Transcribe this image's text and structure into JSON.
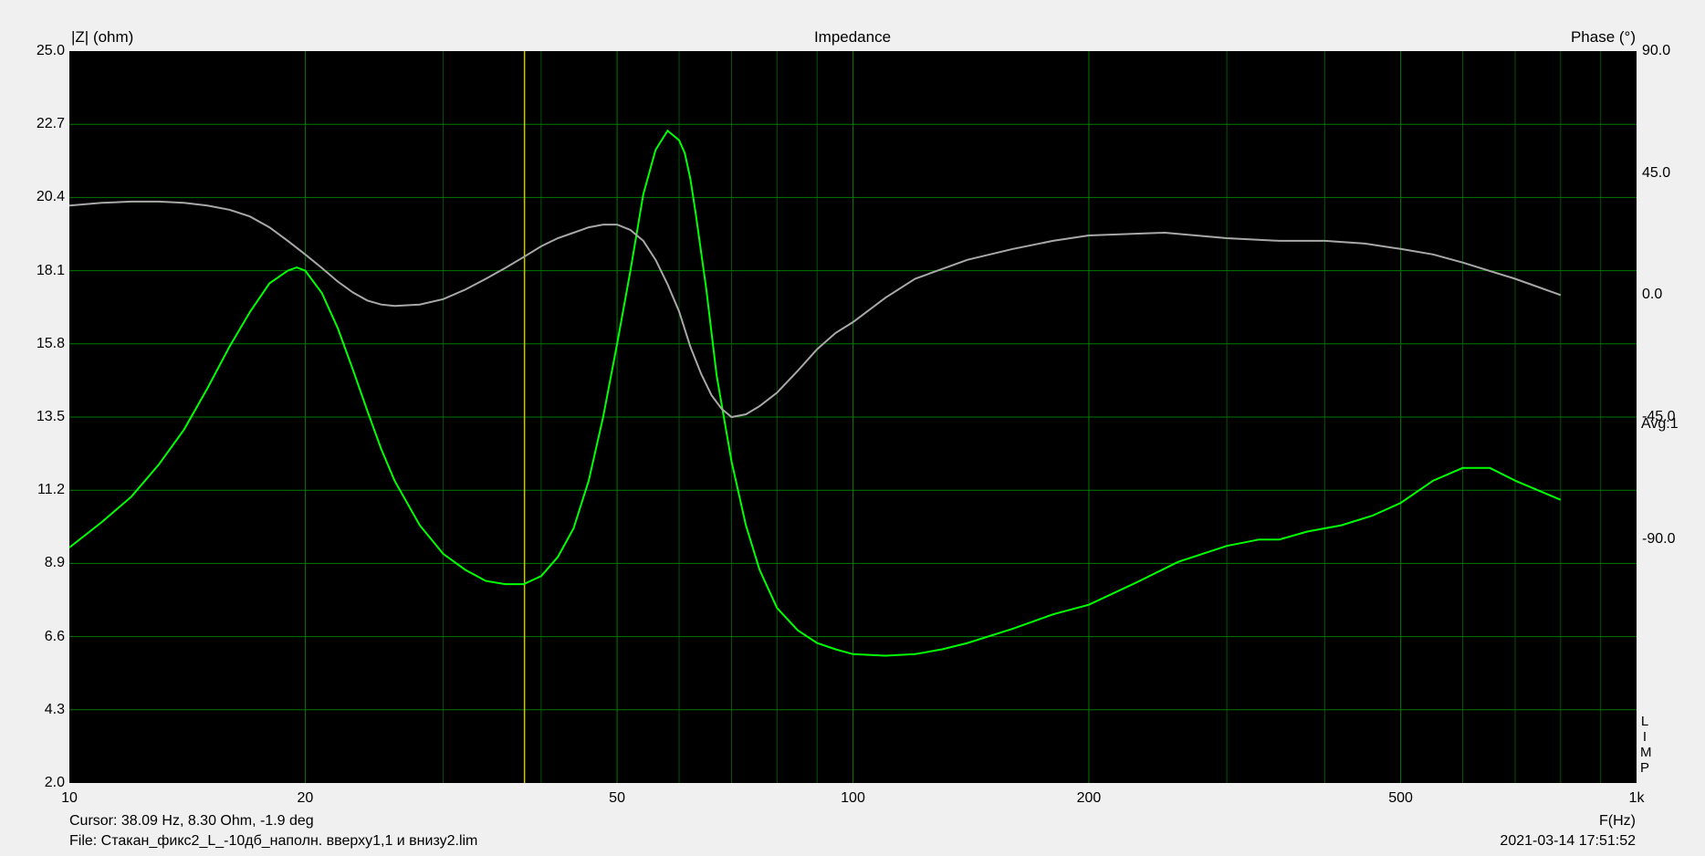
{
  "chart_data": {
    "type": "line",
    "title": "Impedance",
    "ylabel_left": "|Z| (ohm)",
    "ylabel_right": "Phase (°)",
    "xlabel": "F(Hz)",
    "xscale": "log",
    "xlim": [
      10,
      1000
    ],
    "ylim_left": [
      2.0,
      25.0
    ],
    "ylim_right": [
      -180,
      90
    ],
    "x_tick_labels": [
      {
        "v": 10,
        "t": "10"
      },
      {
        "v": 20,
        "t": "20"
      },
      {
        "v": 50,
        "t": "50"
      },
      {
        "v": 100,
        "t": "100"
      },
      {
        "v": 200,
        "t": "200"
      },
      {
        "v": 500,
        "t": "500"
      },
      {
        "v": 1000,
        "t": "1k"
      }
    ],
    "y_left_ticks": [
      "2.0",
      "4.3",
      "6.6",
      "8.9",
      "11.2",
      "13.5",
      "15.8",
      "18.1",
      "20.4",
      "22.7",
      "25.0"
    ],
    "y_right_ticks": [
      {
        "v": 90,
        "t": "90.0"
      },
      {
        "v": 45,
        "t": "45.0"
      },
      {
        "v": 0,
        "t": "0.0"
      },
      {
        "v": -45,
        "t": "-45.0"
      },
      {
        "v": -90,
        "t": "-90.0"
      }
    ],
    "grid": true,
    "avg_label": "Avg:1",
    "lim_label": [
      "L",
      "I",
      "M",
      "P"
    ],
    "cursor": {
      "x": 38.09
    },
    "series": [
      {
        "color": "#00ff00",
        "axis": "left",
        "x": [
          10,
          11,
          12,
          13,
          14,
          15,
          16,
          17,
          18,
          19,
          19.5,
          20,
          21,
          22,
          23,
          24,
          25,
          26,
          28,
          30,
          32,
          34,
          36,
          38,
          40,
          42,
          44,
          46,
          48,
          50,
          52,
          54,
          56,
          58,
          60,
          61,
          62,
          63,
          65,
          67,
          70,
          73,
          76,
          80,
          85,
          90,
          95,
          100,
          110,
          120,
          130,
          140,
          160,
          180,
          200,
          230,
          260,
          300,
          330,
          350,
          380,
          420,
          460,
          500,
          550,
          600,
          650,
          700,
          800
        ],
        "y": [
          9.4,
          10.2,
          11.0,
          12.0,
          13.1,
          14.4,
          15.7,
          16.8,
          17.7,
          18.1,
          18.2,
          18.1,
          17.4,
          16.3,
          15.0,
          13.7,
          12.5,
          11.5,
          10.1,
          9.2,
          8.7,
          8.35,
          8.25,
          8.25,
          8.5,
          9.1,
          10.0,
          11.5,
          13.5,
          15.8,
          18.1,
          20.5,
          21.9,
          22.5,
          22.2,
          21.8,
          21.0,
          19.9,
          17.5,
          14.8,
          12.1,
          10.1,
          8.7,
          7.5,
          6.8,
          6.4,
          6.2,
          6.05,
          6.0,
          6.05,
          6.2,
          6.4,
          6.85,
          7.3,
          7.6,
          8.3,
          8.95,
          9.45,
          9.65,
          9.65,
          9.9,
          10.1,
          10.4,
          10.8,
          11.5,
          11.9,
          11.9,
          11.5,
          10.9
        ]
      },
      {
        "color": "#a8a8a8",
        "axis": "right",
        "x": [
          10,
          11,
          12,
          13,
          14,
          15,
          16,
          17,
          18,
          19,
          20,
          21,
          22,
          23,
          24,
          25,
          26,
          28,
          30,
          32,
          34,
          36,
          38,
          40,
          42,
          44,
          46,
          48,
          50,
          52,
          54,
          56,
          58,
          60,
          62,
          64,
          66,
          68,
          70,
          73,
          76,
          80,
          85,
          90,
          95,
          100,
          110,
          120,
          140,
          160,
          180,
          200,
          250,
          300,
          350,
          400,
          450,
          500,
          550,
          600,
          700,
          800
        ],
        "y": [
          33,
          34,
          34.5,
          34.5,
          34,
          33,
          31.5,
          29,
          25,
          20,
          15,
          10,
          5,
          1,
          -2,
          -3.5,
          -4,
          -3.5,
          -1.5,
          2,
          6,
          10,
          14,
          18,
          21,
          23,
          25,
          26,
          26,
          24,
          20,
          13,
          4,
          -6,
          -19,
          -29,
          -37,
          -42,
          -45,
          -44,
          -41,
          -36,
          -28,
          -20,
          -14,
          -10,
          -1,
          6,
          13,
          17,
          20,
          22,
          23,
          21,
          20,
          20,
          19,
          17,
          15,
          12,
          6,
          0
        ]
      }
    ]
  },
  "footer": {
    "cursor_text": "Cursor: 38.09 Hz, 8.30 Ohm, -1.9 deg",
    "file_text": "File: Стакан_фикс2_L_-10дб_наполн. вверху1,1 и внизу2.lim",
    "timestamp": "2021-03-14 17:51:52"
  },
  "colors": {
    "background": "#000000",
    "grid_major": "#007800",
    "grid_minor": "#005500",
    "cursor_line": "#c8c800",
    "frame": "#f0f0f0"
  }
}
